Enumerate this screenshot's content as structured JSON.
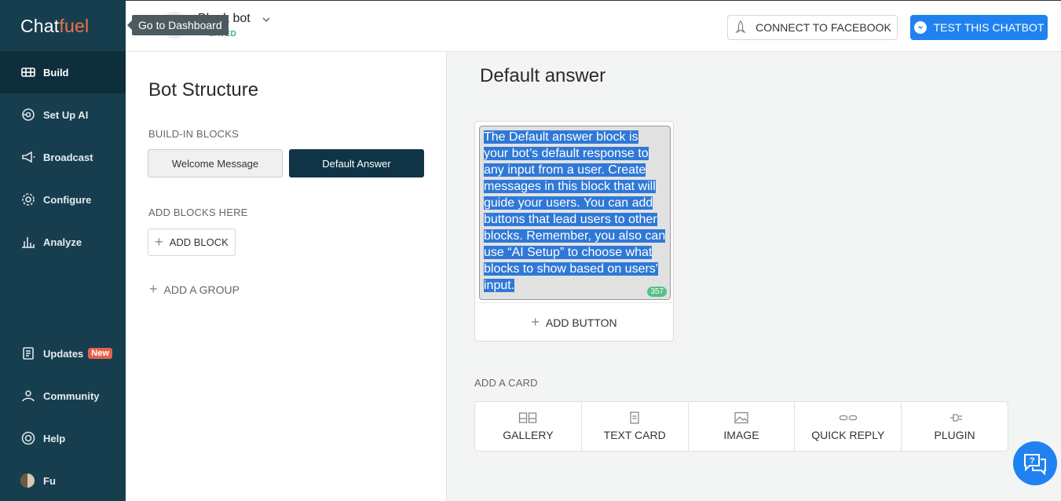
{
  "app": {
    "logo_part1": "Chat",
    "logo_part2": "fuel"
  },
  "sidebar": {
    "items": [
      {
        "label": "Build",
        "icon": "build-icon"
      },
      {
        "label": "Set Up AI",
        "icon": "ai-icon"
      },
      {
        "label": "Broadcast",
        "icon": "megaphone-icon"
      },
      {
        "label": "Configure",
        "icon": "gear-icon"
      },
      {
        "label": "Analyze",
        "icon": "chart-icon"
      }
    ],
    "updates": {
      "label": "Updates",
      "badge": "New"
    },
    "community": {
      "label": "Community"
    },
    "help": {
      "label": "Help"
    },
    "user": {
      "label": "Fu"
    }
  },
  "header": {
    "tooltip": "Go to Dashboard",
    "bot_name": "Blank bot",
    "saved": "SAVED",
    "connect": "CONNECT TO FACEBOOK",
    "test": "TEST THIS CHATBOT"
  },
  "structure": {
    "title": "Bot Structure",
    "built_in_label": "BUILD-IN BLOCKS",
    "welcome": "Welcome Message",
    "default": "Default Answer",
    "add_blocks_label": "ADD BLOCKS HERE",
    "add_block": "ADD BLOCK",
    "add_group": "ADD A GROUP"
  },
  "main": {
    "title": "Default answer",
    "card_text": "The Default answer block is your bot’s default response to any input from a user. Create messages in this block that will guide your users. You can add buttons that lead users to other blocks. Remember, you also can use “AI Setup” to choose what blocks to show based on users' input.",
    "counter": "357",
    "add_button": "ADD BUTTON",
    "add_card_label": "ADD A CARD",
    "card_options": [
      "GALLERY",
      "TEXT CARD",
      "IMAGE",
      "QUICK REPLY",
      "PLUGIN"
    ]
  },
  "colors": {
    "sidebar_bg": "#173e4f",
    "accent_blue": "#1f82f0",
    "logo_orange": "#f0724a",
    "badge_red": "#e8604c"
  }
}
